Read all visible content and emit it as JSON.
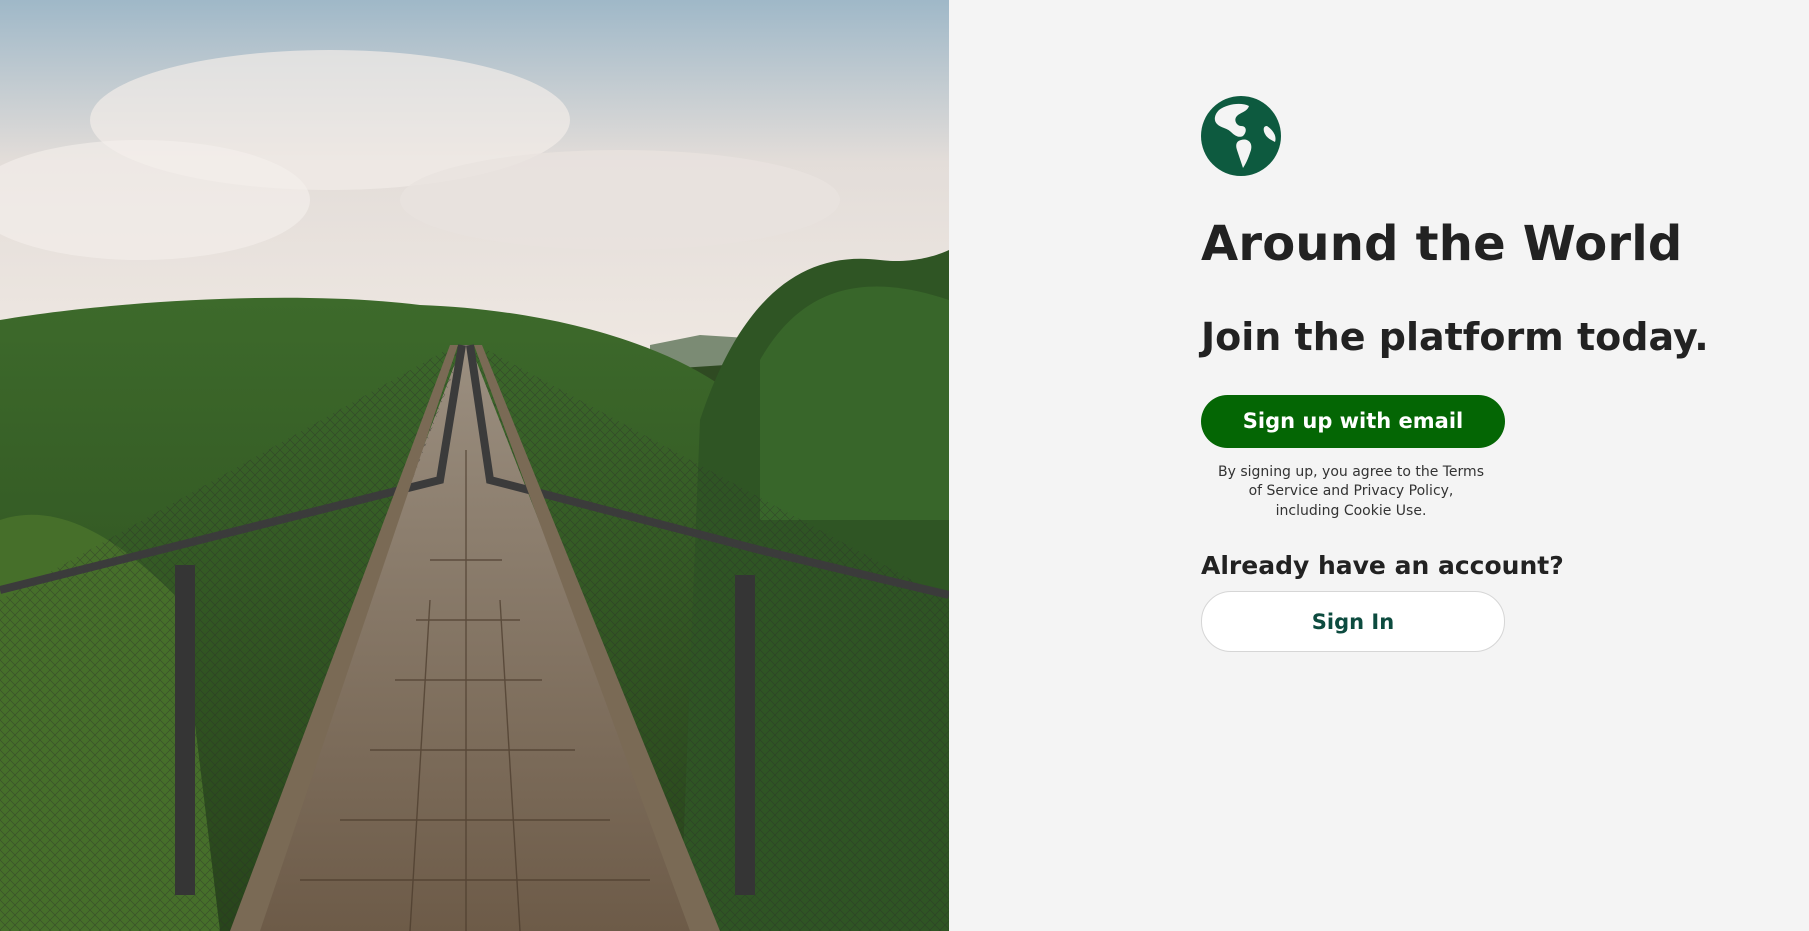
{
  "hero": {
    "image_subject": "wooden suspension bridge over forested hills"
  },
  "brand": {
    "logo_icon": "globe-americas-icon",
    "logo_color": "#0d5a3f",
    "title": "Around the World"
  },
  "signup": {
    "tagline": "Join the platform today.",
    "button_label": "Sign up with email",
    "button_color": "#046604",
    "legal_text": "By signing up, you agree to the Terms of Service and Privacy Policy, including Cookie Use."
  },
  "signin": {
    "prompt": "Already have an account?",
    "button_label": "Sign In",
    "button_text_color": "#0d4b3f"
  }
}
